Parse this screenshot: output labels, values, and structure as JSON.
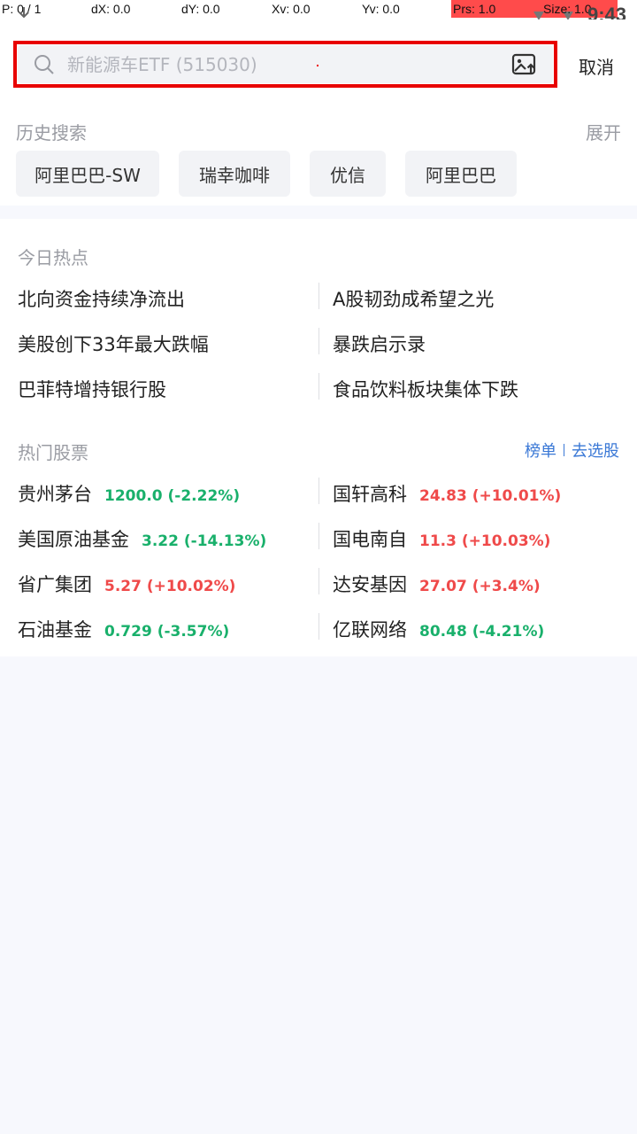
{
  "status": {
    "p": "P: 0 / 1",
    "dx": "dX: 0.0",
    "dy": "dY: 0.0",
    "xv": "Xv: 0.0",
    "yv": "Yv: 0.0",
    "prs": "Prs: 1.0",
    "size": "Size: 1.0",
    "time": "9:43"
  },
  "search": {
    "placeholder": "新能源车ETF (515030)",
    "cancel": "取消"
  },
  "history": {
    "title": "历史搜索",
    "expand": "展开",
    "chips": [
      "阿里巴巴-SW",
      "瑞幸咖啡",
      "优信",
      "阿里巴巴"
    ]
  },
  "hot_topics": {
    "title": "今日热点",
    "items": [
      "北向资金持续净流出",
      "A股韧劲成希望之光",
      "美股创下33年最大跌幅",
      "暴跌启示录",
      "巴菲特增持银行股",
      "食品饮料板块集体下跌"
    ]
  },
  "hot_stocks": {
    "title": "热门股票",
    "link_rank": "榜单",
    "link_pick": "去选股",
    "items": [
      {
        "name": "贵州茅台",
        "quote": "1200.0 (-2.22%)",
        "trend": "down"
      },
      {
        "name": "国轩高科",
        "quote": "24.83 (+10.01%)",
        "trend": "up"
      },
      {
        "name": "美国原油基金",
        "quote": "3.22 (-14.13%)",
        "trend": "down"
      },
      {
        "name": "国电南自",
        "quote": "11.3 (+10.03%)",
        "trend": "up"
      },
      {
        "name": "省广集团",
        "quote": "5.27 (+10.02%)",
        "trend": "up"
      },
      {
        "name": "达安基因",
        "quote": "27.07 (+3.4%)",
        "trend": "up"
      },
      {
        "name": "石油基金",
        "quote": "0.729 (-3.57%)",
        "trend": "down"
      },
      {
        "name": "亿联网络",
        "quote": "80.48 (-4.21%)",
        "trend": "down"
      }
    ]
  },
  "colors": {
    "up": "#ef4a4a",
    "down": "#19b06b",
    "link": "#3a78d6",
    "highlight": "#e80000"
  }
}
